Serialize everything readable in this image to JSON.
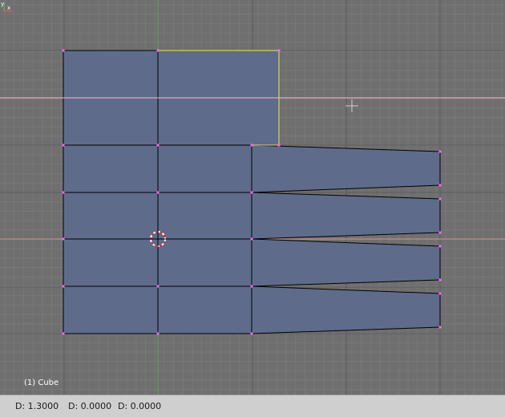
{
  "viewport": {
    "object_info": "(1) Cube",
    "axis_labels": {
      "x": "x",
      "y": "y"
    },
    "colors": {
      "background": "#6f6f6f",
      "grid_minor": "#787878",
      "grid_major": "#5c5c5c",
      "x_axis": "#d88a8a",
      "y_axis": "#52a852",
      "constraint_line": "#ffb3c8",
      "face_fill": "#5f6b8a",
      "edge": "#000000",
      "selected_edge": "#e8e84a",
      "vertex": "#ff66ff"
    }
  },
  "statusbar": {
    "d1": "D: 1.3000",
    "d2": "D: 0.0000",
    "d3": "D: 0.0000"
  }
}
